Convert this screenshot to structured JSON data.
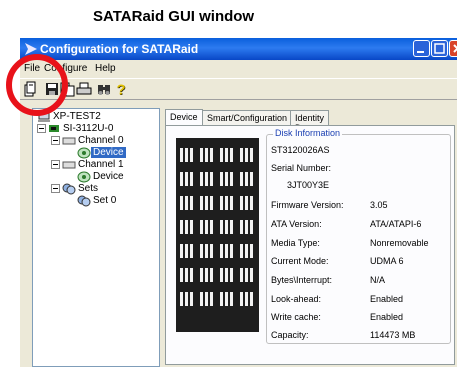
{
  "caption": "SATARaid GUI window",
  "window": {
    "title": "Configuration for SATARaid"
  },
  "menu": {
    "file": "File",
    "configure": "Configure",
    "help": "Help"
  },
  "toolbar": {
    "icons": [
      "new-config-icon",
      "save-icon",
      "copy-icon",
      "print-icon",
      "binoculars-icon",
      "help-icon"
    ]
  },
  "tree": {
    "root": "XP-TEST2",
    "controller": "SI-3112U-0",
    "channel0": "Channel 0",
    "device0": "Device",
    "channel1": "Channel 1",
    "device1": "Device",
    "sets": "Sets",
    "set0": "Set 0"
  },
  "tabs": {
    "device": "Device",
    "smart": "Smart/Configuration",
    "identity": "Identity Data"
  },
  "disk_info": {
    "legend": "Disk Information",
    "model": "ST3120026AS",
    "serial_label": "Serial Number:",
    "serial_value": "3JT00Y3E",
    "firmware_label": "Firmware Version:",
    "firmware_value": "3.05",
    "ata_label": "ATA Version:",
    "ata_value": "ATA/ATAPI-6",
    "media_label": "Media Type:",
    "media_value": "Nonremovable",
    "mode_label": "Current Mode:",
    "mode_value": "UDMA 6",
    "bytes_label": "Bytes\\Interrupt:",
    "bytes_value": "N/A",
    "lookahead_label": "Look-ahead:",
    "lookahead_value": "Enabled",
    "writecache_label": "Write cache:",
    "writecache_value": "Enabled",
    "capacity_label": "Capacity:",
    "capacity_value": "114473 MB"
  },
  "colors": {
    "titlebar": "#0a5fdc",
    "selection": "#316ac5",
    "highlight_circle": "#e8121a",
    "legend_text": "#1a3fb2"
  }
}
